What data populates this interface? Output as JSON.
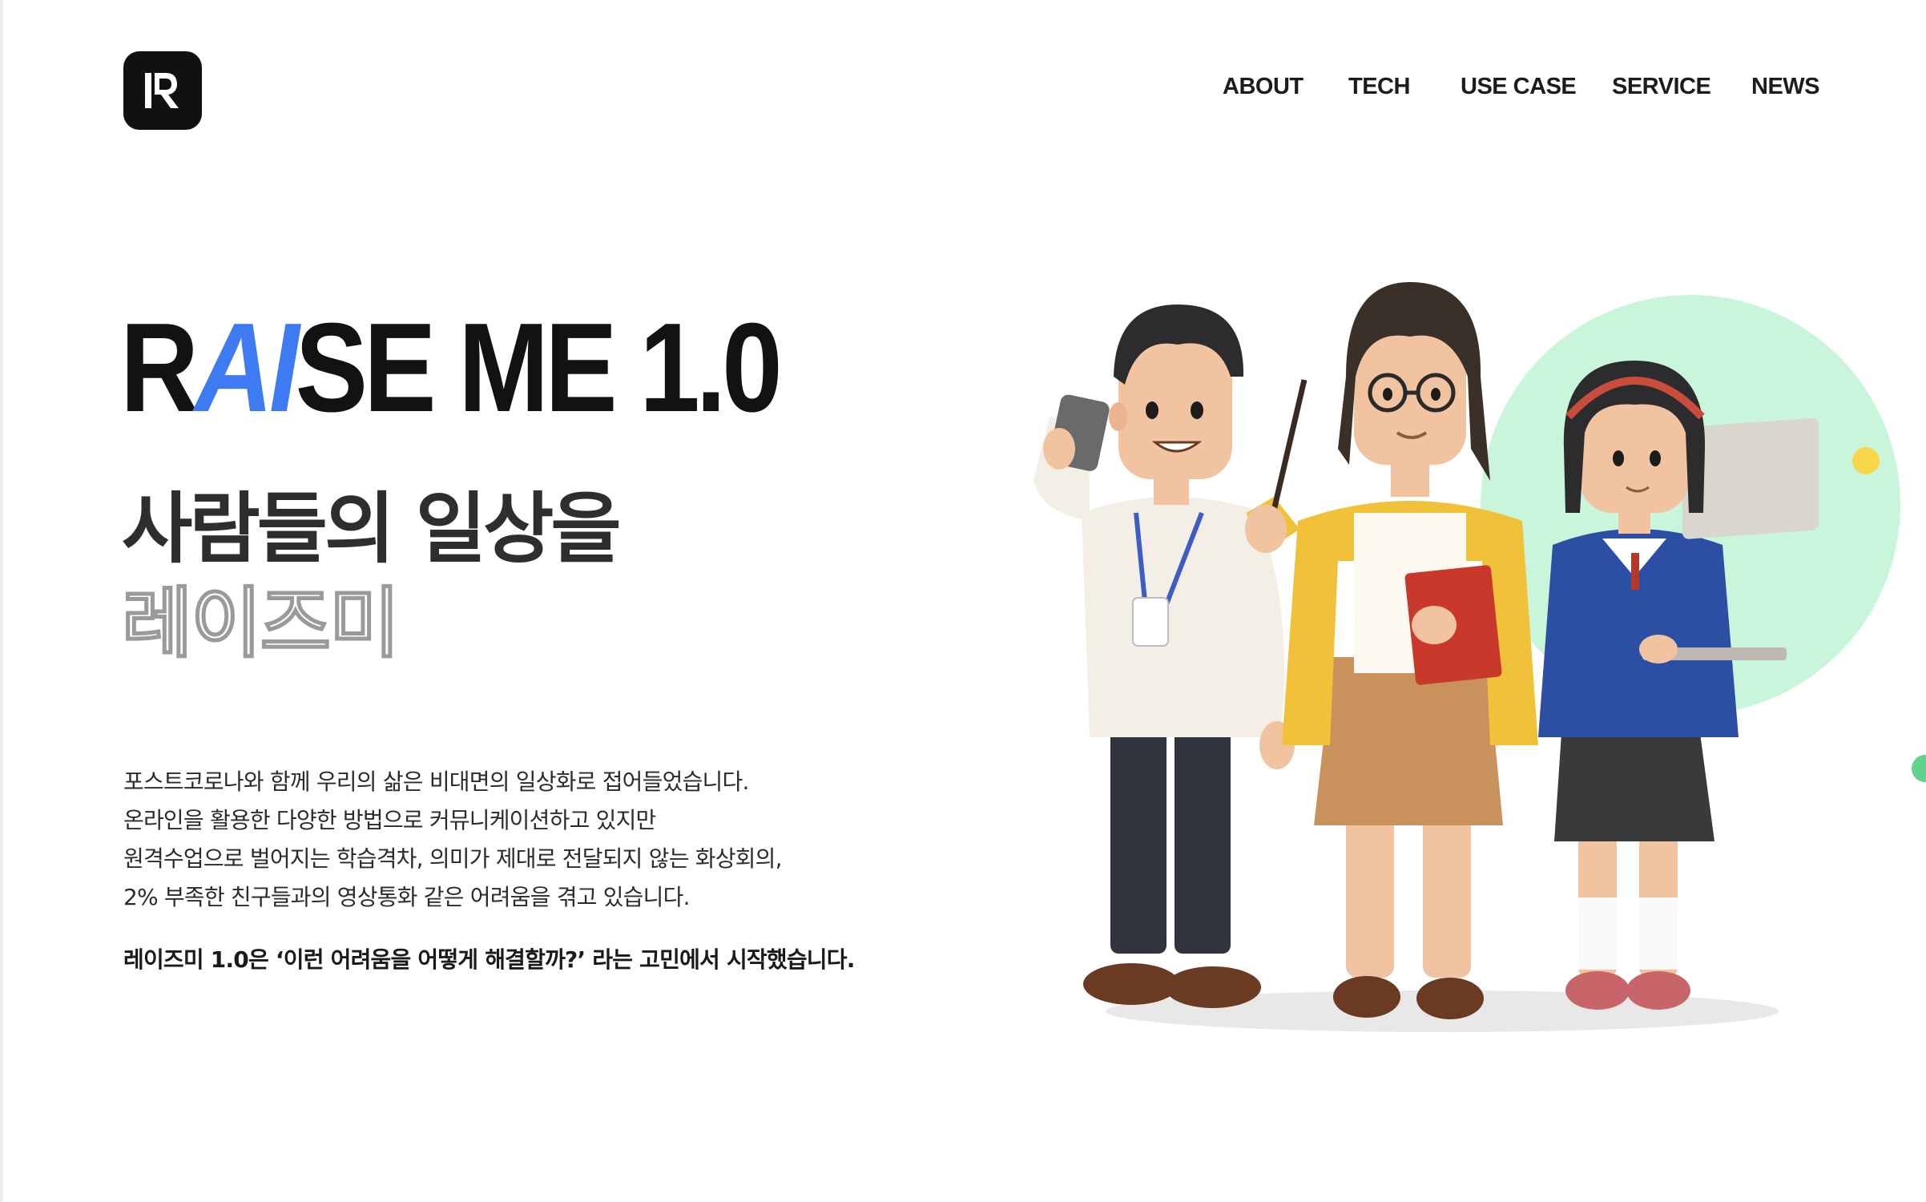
{
  "header": {
    "logo_alt": "R",
    "nav": [
      {
        "label": "ABOUT"
      },
      {
        "label": "TECH"
      },
      {
        "label": "USE CASE"
      },
      {
        "label": "SERVICE"
      },
      {
        "label": "NEWS"
      }
    ]
  },
  "hero": {
    "title_part1": "R",
    "title_ai": "AI",
    "title_part2": "SE ME 1.0",
    "headline": "사람들의 일상을",
    "headline_outline": "레이즈미",
    "description": [
      "포스트코로나와 함께 우리의 삶은 비대면의 일상화로 접어들었습니다.",
      "온라인을 활용한 다양한 방법으로 커뮤니케이션하고 있지만",
      "원격수업으로 벌어지는 학습격차, 의미가 제대로 전달되지 않는 화상회의,",
      "2% 부족한 친구들과의 영상통화 같은 어려움을 겪고 있습니다."
    ],
    "highlight": "레이즈미 1.0은 ‘이런 어려움을 어떻게 해결할까?’ 라는 고민에서 시작했습니다."
  },
  "colors": {
    "accent_blue": "#3e7bf2",
    "mint_circle": "#c9f6db",
    "yellow_dot": "#f7d64a",
    "green_dot": "#5fd48c"
  }
}
